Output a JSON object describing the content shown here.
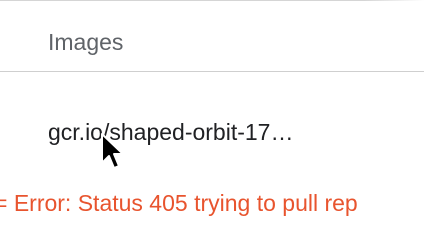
{
  "table": {
    "header": {
      "images_label": "Images"
    },
    "rows": [
      {
        "image": "gcr.io/shaped-orbit-17…"
      }
    ]
  },
  "error": {
    "text": "= Error: Status 405 trying to pull rep"
  },
  "colors": {
    "header_text": "#5f6368",
    "cell_text": "#202124",
    "divider": "#cfcfcf",
    "error_text": "#e8542e"
  },
  "icons": {
    "cursor": "mouse-pointer-icon"
  }
}
